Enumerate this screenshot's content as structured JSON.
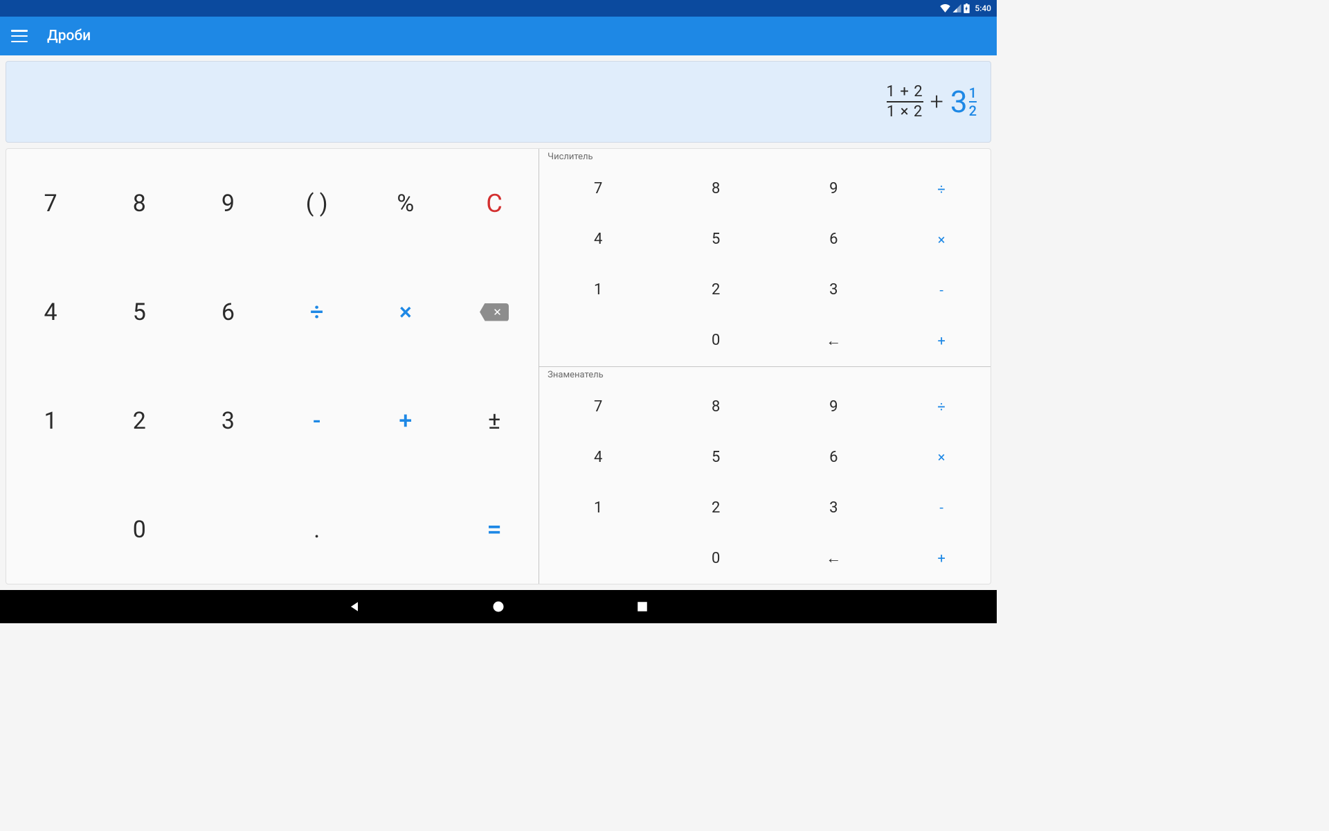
{
  "status": {
    "time": "5:40"
  },
  "appbar": {
    "title": "Дроби"
  },
  "expression": {
    "fraction": {
      "numerator": "1 + 2",
      "denominator": "1 × 2"
    },
    "operator": "+",
    "mixed": {
      "whole": "3",
      "num": "1",
      "den": "2"
    }
  },
  "main_keys": {
    "r0": [
      "7",
      "8",
      "9",
      "( )",
      "%",
      "C"
    ],
    "r1": [
      "4",
      "5",
      "6",
      "÷",
      "×",
      "⌫"
    ],
    "r2": [
      "1",
      "2",
      "3",
      "-",
      "+",
      "±"
    ],
    "r3": [
      "",
      "0",
      "",
      ".",
      "",
      "="
    ]
  },
  "side": {
    "numerator_label": "Числитель",
    "denominator_label": "Знаменатель",
    "rows": {
      "r0": [
        "7",
        "8",
        "9",
        "÷"
      ],
      "r1": [
        "4",
        "5",
        "6",
        "×"
      ],
      "r2": [
        "1",
        "2",
        "3",
        "-"
      ],
      "r3": [
        "",
        "0",
        "←",
        "+"
      ]
    }
  }
}
